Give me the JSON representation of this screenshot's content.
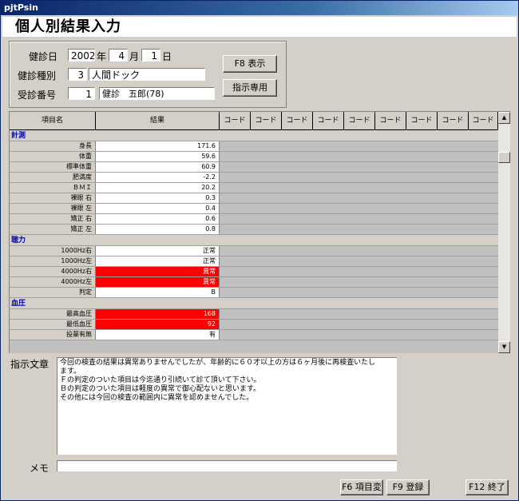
{
  "window": {
    "title": "pjtPsin"
  },
  "page": {
    "heading": "個人別結果入力"
  },
  "info": {
    "date_label": "健診日",
    "year": "2002",
    "year_unit": "年",
    "month": "4",
    "month_unit": "月",
    "day": "1",
    "day_unit": "日",
    "type_label": "健診種別",
    "type_code": "3",
    "type_name": "人間ドック",
    "number_label": "受診番号",
    "number": "1",
    "patient": "健診　五郎(78)"
  },
  "buttons": {
    "f8": "F8 表示",
    "instruction_only": "指示専用",
    "f6": "F6 項目変",
    "f9": "F9 登録",
    "f12": "F12 終了"
  },
  "grid": {
    "headers": [
      "項目名",
      "結果",
      "コード",
      "コード",
      "コード",
      "コード",
      "コード",
      "コード",
      "コード",
      "コード",
      "コード"
    ],
    "sections": [
      {
        "name": "計測",
        "rows": [
          {
            "item": "身長",
            "result": "171.6",
            "alert": false
          },
          {
            "item": "体重",
            "result": "59.6",
            "alert": false
          },
          {
            "item": "標準体重",
            "result": "60.9",
            "alert": false
          },
          {
            "item": "肥満度",
            "result": "-2.2",
            "alert": false
          },
          {
            "item": "ＢＭＩ",
            "result": "20.2",
            "alert": false
          },
          {
            "item": "裸眼 右",
            "result": "0.3",
            "alert": false
          },
          {
            "item": "裸眼 左",
            "result": "0.4",
            "alert": false
          },
          {
            "item": "矯正 右",
            "result": "0.6",
            "alert": false
          },
          {
            "item": "矯正 左",
            "result": "0.8",
            "alert": false
          }
        ]
      },
      {
        "name": "聴力",
        "rows": [
          {
            "item": "1000Hz右",
            "result": "正常",
            "alert": false
          },
          {
            "item": "1000Hz左",
            "result": "正常",
            "alert": false
          },
          {
            "item": "4000Hz右",
            "result": "異常",
            "alert": true
          },
          {
            "item": "4000Hz左",
            "result": "異常",
            "alert": true
          },
          {
            "item": "判定",
            "result": "B",
            "alert": false
          }
        ]
      },
      {
        "name": "血圧",
        "rows": [
          {
            "item": "最高血圧",
            "result": "168",
            "alert": true
          },
          {
            "item": "最低血圧",
            "result": "92",
            "alert": true
          },
          {
            "item": "投薬有無",
            "result": "有",
            "alert": false
          }
        ]
      }
    ]
  },
  "instruction": {
    "label": "指示文章",
    "lines": [
      "今回の検査の結果は異常ありませんでしたが、年齢的に６０才以上の方は６ヶ月後に再検査いたし",
      "ます。",
      "Ｆの判定のついた項目は今迄通り引続いて診て頂いて下さい。",
      "Ｂの判定のついた項目は軽度の異常で御心配ないと思います。",
      "その他には今回の検査の範囲内に異常を認めませんでした。"
    ]
  },
  "memo": {
    "label": "メモ",
    "value": ""
  }
}
